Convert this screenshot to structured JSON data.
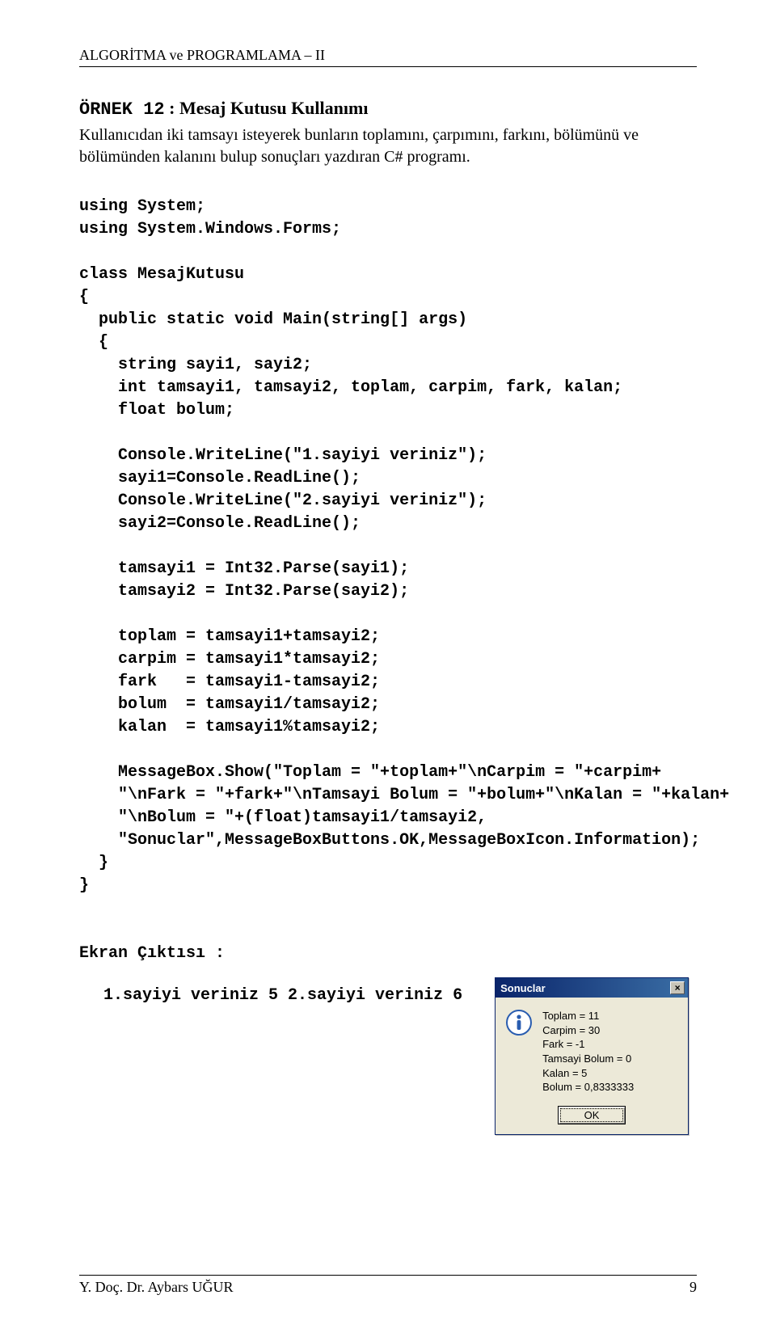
{
  "header": "ALGORİTMA ve PROGRAMLAMA – II",
  "title": {
    "num": "ÖRNEK 12",
    "rest": " : Mesaj Kutusu Kullanımı"
  },
  "intro": "Kullanıcıdan iki tamsayı isteyerek bunların toplamını, çarpımını, farkını, bölümünü ve bölümünden kalanını bulup sonuçları yazdıran C# programı.",
  "code": "using System;\nusing System.Windows.Forms;\n\nclass MesajKutusu\n{\n  public static void Main(string[] args)\n  {\n    string sayi1, sayi2;\n    int tamsayi1, tamsayi2, toplam, carpim, fark, kalan;\n    float bolum;\n\n    Console.WriteLine(\"1.sayiyi veriniz\");\n    sayi1=Console.ReadLine();\n    Console.WriteLine(\"2.sayiyi veriniz\");\n    sayi2=Console.ReadLine();\n\n    tamsayi1 = Int32.Parse(sayi1);\n    tamsayi2 = Int32.Parse(sayi2);\n\n    toplam = tamsayi1+tamsayi2;\n    carpim = tamsayi1*tamsayi2;\n    fark   = tamsayi1-tamsayi2;\n    bolum  = tamsayi1/tamsayi2;\n    kalan  = tamsayi1%tamsayi2;\n\n    MessageBox.Show(\"Toplam = \"+toplam+\"\\nCarpim = \"+carpim+\n    \"\\nFark = \"+fark+\"\\nTamsayi Bolum = \"+bolum+\"\\nKalan = \"+kalan+\n    \"\\nBolum = \"+(float)tamsayi1/tamsayi2,\n    \"Sonuclar\",MessageBoxButtons.OK,MessageBoxIcon.Information);\n  }\n}",
  "outputLabel": "Ekran Çıktısı :",
  "consoleOutput": "1.sayiyi veriniz\n5\n2.sayiyi veriniz\n6",
  "msgbox": {
    "title": "Sonuclar",
    "close": "×",
    "text": "Toplam = 11\nCarpim = 30\nFark = -1\nTamsayi Bolum = 0\nKalan = 5\nBolum = 0,8333333",
    "ok": "OK"
  },
  "footer": {
    "left": "Y. Doç. Dr. Aybars UĞUR",
    "right": "9"
  }
}
